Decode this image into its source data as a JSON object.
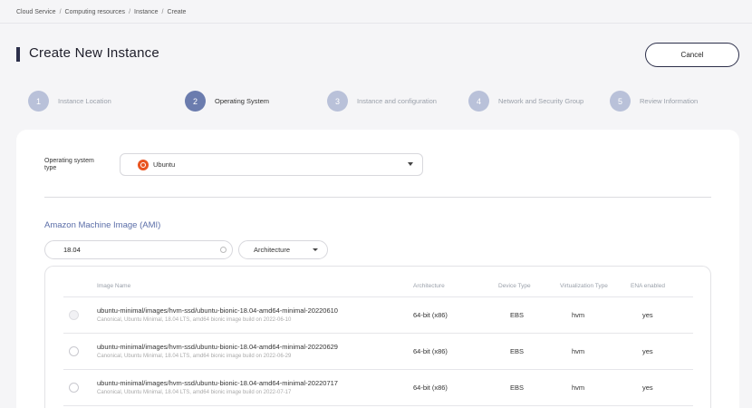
{
  "breadcrumb": [
    "Cloud Service",
    "Computing resources",
    "Instance",
    "Create"
  ],
  "page_title": "Create New Instance",
  "cancel_label": "Cancel",
  "steps": [
    {
      "number": "1",
      "label": "Instance Location"
    },
    {
      "number": "2",
      "label": "Operating System"
    },
    {
      "number": "3",
      "label": "Instance and configuration"
    },
    {
      "number": "4",
      "label": "Network and Security Group"
    },
    {
      "number": "5",
      "label": "Review Information"
    }
  ],
  "active_step": "2",
  "os": {
    "label": "Operating system type",
    "value": "Ubuntu"
  },
  "ami": {
    "title": "Amazon Machine Image (AMI)",
    "search_value": "18.04",
    "architecture_label": "Architecture",
    "columns": [
      "Image Name",
      "Architecture",
      "Device Type",
      "Virtualization Type",
      "ENA enabled"
    ],
    "rows": [
      {
        "name": "ubuntu-minimal/images/hvm-ssd/ubuntu-bionic-18.04-amd64-minimal-20220610",
        "description": "Canonical, Ubuntu Minimal, 18.04 LTS, amd64 bionic image build on 2022-06-10",
        "architecture": "64-bit (x86)",
        "device_type": "EBS",
        "virtualization": "hvm",
        "ena": "yes"
      },
      {
        "name": "ubuntu-minimal/images/hvm-ssd/ubuntu-bionic-18.04-amd64-minimal-20220629",
        "description": "Canonical, Ubuntu Minimal, 18.04 LTS, amd64 bionic image build on 2022-06-29",
        "architecture": "64-bit (x86)",
        "device_type": "EBS",
        "virtualization": "hvm",
        "ena": "yes"
      },
      {
        "name": "ubuntu-minimal/images/hvm-ssd/ubuntu-bionic-18.04-amd64-minimal-20220717",
        "description": "Canonical, Ubuntu Minimal, 18.04 LTS, amd64 bionic image build on 2022-07-17",
        "architecture": "64-bit (x86)",
        "device_type": "EBS",
        "virtualization": "hvm",
        "ena": "yes"
      }
    ]
  },
  "colors": {
    "accent": "#6b7cae",
    "step_inactive": "#b9c1d9",
    "ubuntu": "#e95420",
    "section_title": "#5b6ea8"
  },
  "icons": {
    "os": "ubuntu-logo-icon",
    "search": "search-icon",
    "dropdown": "chevron-down-icon"
  }
}
